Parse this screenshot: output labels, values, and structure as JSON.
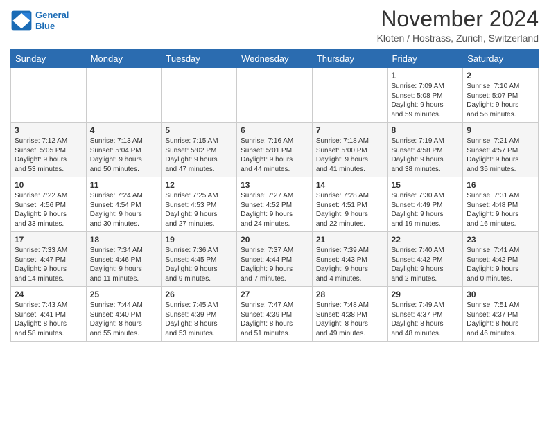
{
  "logo": {
    "line1": "General",
    "line2": "Blue"
  },
  "title": "November 2024",
  "location": "Kloten / Hostrass, Zurich, Switzerland",
  "days_of_week": [
    "Sunday",
    "Monday",
    "Tuesday",
    "Wednesday",
    "Thursday",
    "Friday",
    "Saturday"
  ],
  "weeks": [
    [
      {
        "day": "",
        "content": ""
      },
      {
        "day": "",
        "content": ""
      },
      {
        "day": "",
        "content": ""
      },
      {
        "day": "",
        "content": ""
      },
      {
        "day": "",
        "content": ""
      },
      {
        "day": "1",
        "content": "Sunrise: 7:09 AM\nSunset: 5:08 PM\nDaylight: 9 hours\nand 59 minutes."
      },
      {
        "day": "2",
        "content": "Sunrise: 7:10 AM\nSunset: 5:07 PM\nDaylight: 9 hours\nand 56 minutes."
      }
    ],
    [
      {
        "day": "3",
        "content": "Sunrise: 7:12 AM\nSunset: 5:05 PM\nDaylight: 9 hours\nand 53 minutes."
      },
      {
        "day": "4",
        "content": "Sunrise: 7:13 AM\nSunset: 5:04 PM\nDaylight: 9 hours\nand 50 minutes."
      },
      {
        "day": "5",
        "content": "Sunrise: 7:15 AM\nSunset: 5:02 PM\nDaylight: 9 hours\nand 47 minutes."
      },
      {
        "day": "6",
        "content": "Sunrise: 7:16 AM\nSunset: 5:01 PM\nDaylight: 9 hours\nand 44 minutes."
      },
      {
        "day": "7",
        "content": "Sunrise: 7:18 AM\nSunset: 5:00 PM\nDaylight: 9 hours\nand 41 minutes."
      },
      {
        "day": "8",
        "content": "Sunrise: 7:19 AM\nSunset: 4:58 PM\nDaylight: 9 hours\nand 38 minutes."
      },
      {
        "day": "9",
        "content": "Sunrise: 7:21 AM\nSunset: 4:57 PM\nDaylight: 9 hours\nand 35 minutes."
      }
    ],
    [
      {
        "day": "10",
        "content": "Sunrise: 7:22 AM\nSunset: 4:56 PM\nDaylight: 9 hours\nand 33 minutes."
      },
      {
        "day": "11",
        "content": "Sunrise: 7:24 AM\nSunset: 4:54 PM\nDaylight: 9 hours\nand 30 minutes."
      },
      {
        "day": "12",
        "content": "Sunrise: 7:25 AM\nSunset: 4:53 PM\nDaylight: 9 hours\nand 27 minutes."
      },
      {
        "day": "13",
        "content": "Sunrise: 7:27 AM\nSunset: 4:52 PM\nDaylight: 9 hours\nand 24 minutes."
      },
      {
        "day": "14",
        "content": "Sunrise: 7:28 AM\nSunset: 4:51 PM\nDaylight: 9 hours\nand 22 minutes."
      },
      {
        "day": "15",
        "content": "Sunrise: 7:30 AM\nSunset: 4:49 PM\nDaylight: 9 hours\nand 19 minutes."
      },
      {
        "day": "16",
        "content": "Sunrise: 7:31 AM\nSunset: 4:48 PM\nDaylight: 9 hours\nand 16 minutes."
      }
    ],
    [
      {
        "day": "17",
        "content": "Sunrise: 7:33 AM\nSunset: 4:47 PM\nDaylight: 9 hours\nand 14 minutes."
      },
      {
        "day": "18",
        "content": "Sunrise: 7:34 AM\nSunset: 4:46 PM\nDaylight: 9 hours\nand 11 minutes."
      },
      {
        "day": "19",
        "content": "Sunrise: 7:36 AM\nSunset: 4:45 PM\nDaylight: 9 hours\nand 9 minutes."
      },
      {
        "day": "20",
        "content": "Sunrise: 7:37 AM\nSunset: 4:44 PM\nDaylight: 9 hours\nand 7 minutes."
      },
      {
        "day": "21",
        "content": "Sunrise: 7:39 AM\nSunset: 4:43 PM\nDaylight: 9 hours\nand 4 minutes."
      },
      {
        "day": "22",
        "content": "Sunrise: 7:40 AM\nSunset: 4:42 PM\nDaylight: 9 hours\nand 2 minutes."
      },
      {
        "day": "23",
        "content": "Sunrise: 7:41 AM\nSunset: 4:42 PM\nDaylight: 9 hours\nand 0 minutes."
      }
    ],
    [
      {
        "day": "24",
        "content": "Sunrise: 7:43 AM\nSunset: 4:41 PM\nDaylight: 8 hours\nand 58 minutes."
      },
      {
        "day": "25",
        "content": "Sunrise: 7:44 AM\nSunset: 4:40 PM\nDaylight: 8 hours\nand 55 minutes."
      },
      {
        "day": "26",
        "content": "Sunrise: 7:45 AM\nSunset: 4:39 PM\nDaylight: 8 hours\nand 53 minutes."
      },
      {
        "day": "27",
        "content": "Sunrise: 7:47 AM\nSunset: 4:39 PM\nDaylight: 8 hours\nand 51 minutes."
      },
      {
        "day": "28",
        "content": "Sunrise: 7:48 AM\nSunset: 4:38 PM\nDaylight: 8 hours\nand 49 minutes."
      },
      {
        "day": "29",
        "content": "Sunrise: 7:49 AM\nSunset: 4:37 PM\nDaylight: 8 hours\nand 48 minutes."
      },
      {
        "day": "30",
        "content": "Sunrise: 7:51 AM\nSunset: 4:37 PM\nDaylight: 8 hours\nand 46 minutes."
      }
    ]
  ]
}
